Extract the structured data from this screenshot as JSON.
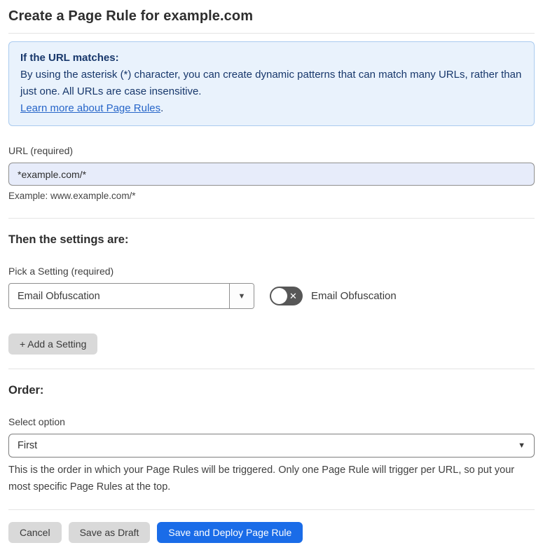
{
  "page": {
    "title": "Create a Page Rule for example.com"
  },
  "info_box": {
    "heading": "If the URL matches:",
    "body": "By using the asterisk (*) character, you can create dynamic patterns that can match many URLs, rather than just one. All URLs are case insensitive.",
    "link_label": "Learn more about Page Rules",
    "link_suffix": "."
  },
  "url_field": {
    "label": "URL (required)",
    "value": "*example.com/*",
    "hint": "Example: www.example.com/*"
  },
  "settings_section": {
    "heading": "Then the settings are:",
    "picker_label": "Pick a Setting (required)",
    "picker_value": "Email Obfuscation",
    "picker_arrow_icon": "▼",
    "toggle_state": "off",
    "toggle_glyph": "✕",
    "toggle_label": "Email Obfuscation",
    "add_setting_label": "+ Add a Setting"
  },
  "order_section": {
    "heading": "Order:",
    "select_label": "Select option",
    "select_value": "First",
    "select_arrow_icon": "▼",
    "hint": "This is the order in which your Page Rules will be triggered. Only one Page Rule will trigger per URL, so put your most specific Page Rules at the top."
  },
  "footer": {
    "cancel_label": "Cancel",
    "save_draft_label": "Save as Draft",
    "save_deploy_label": "Save and Deploy Page Rule"
  },
  "colors": {
    "accent_blue": "#1a6ce8",
    "info_box_bg": "#e9f2fc",
    "info_box_border": "#abcbef",
    "info_box_text": "#17376b",
    "link_blue": "#2766c9",
    "url_input_bg": "#e7ecfa",
    "toggle_off_bg": "#575757",
    "gray_button_bg": "#d9d9d9"
  }
}
